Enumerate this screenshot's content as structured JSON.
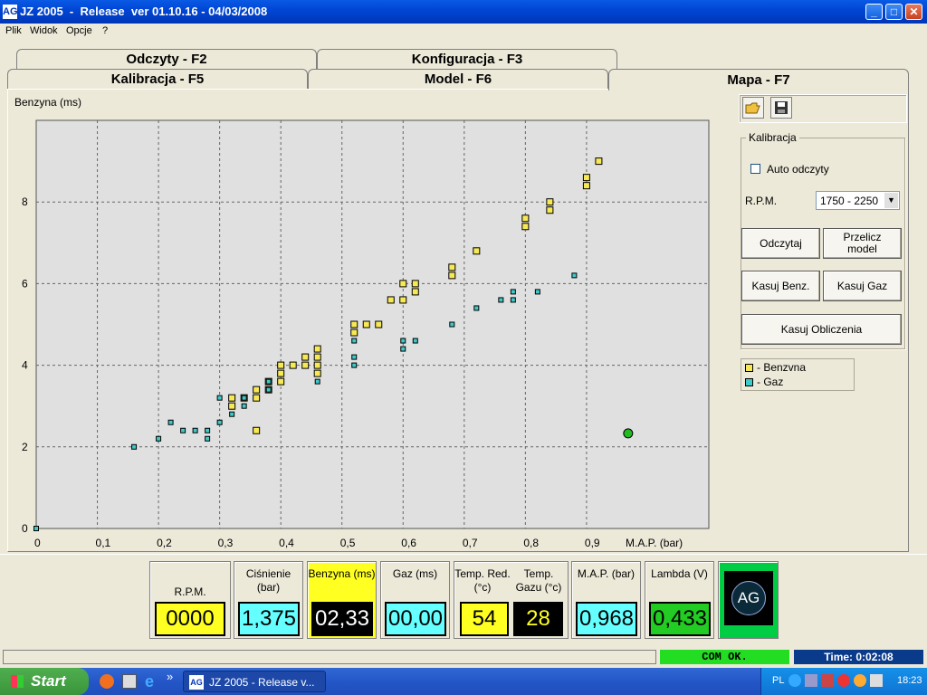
{
  "window": {
    "title": "JZ 2005  -  Release  ver 01.10.16 - 04/03/2008",
    "icon_text": "AG",
    "minimize": "_",
    "maximize": "□",
    "close": "✕"
  },
  "menu": [
    "Plik",
    "Widok",
    "Opcje",
    "?"
  ],
  "tabs": [
    {
      "label": "Odczyty - F2"
    },
    {
      "label": "Konfiguracja - F3"
    },
    {
      "label": "Kalibracja - F5"
    },
    {
      "label": "Model - F6"
    },
    {
      "label": "Mapa - F7"
    }
  ],
  "right_panel": {
    "group_title": "Kalibracja",
    "auto_label": "Auto odczyty",
    "auto_checked": false,
    "rpm_label": "R.P.M.",
    "rpm_value": "1750 - 2250",
    "buttons": {
      "odczytaj": "Odczytaj",
      "przelicz": "Przelicz model",
      "kasuj_benz": "Kasuj Benz.",
      "kasuj_gaz": "Kasuj Gaz",
      "kasuj_obl": "Kasuj Obliczenia"
    },
    "legend": {
      "benzyna": " - Benzvna",
      "gaz": " - Gaz"
    }
  },
  "chart_data": {
    "type": "scatter",
    "ylabel": "Benzyna (ms)",
    "xlabel": "M.A.P. (bar)",
    "xlim": [
      0,
      1.1
    ],
    "ylim": [
      0,
      10
    ],
    "x_ticks": [
      "0",
      "0,1",
      "0,2",
      "0,3",
      "0,4",
      "0,5",
      "0,6",
      "0,7",
      "0,8",
      "0,9"
    ],
    "y_ticks": [
      "0",
      "2",
      "4",
      "6",
      "8"
    ],
    "grid": true,
    "series": [
      {
        "name": "Benzvna",
        "color": "#f7e955",
        "points": [
          [
            0.32,
            3.2
          ],
          [
            0.32,
            3.0
          ],
          [
            0.34,
            3.2
          ],
          [
            0.36,
            3.4
          ],
          [
            0.36,
            3.2
          ],
          [
            0.36,
            2.4
          ],
          [
            0.38,
            3.6
          ],
          [
            0.38,
            3.4
          ],
          [
            0.4,
            4.0
          ],
          [
            0.4,
            3.8
          ],
          [
            0.4,
            3.6
          ],
          [
            0.42,
            4.0
          ],
          [
            0.44,
            4.2
          ],
          [
            0.44,
            4.0
          ],
          [
            0.46,
            4.4
          ],
          [
            0.46,
            4.2
          ],
          [
            0.46,
            4.0
          ],
          [
            0.46,
            3.8
          ],
          [
            0.52,
            5.0
          ],
          [
            0.52,
            4.8
          ],
          [
            0.54,
            5.0
          ],
          [
            0.56,
            5.0
          ],
          [
            0.58,
            5.6
          ],
          [
            0.6,
            6.0
          ],
          [
            0.6,
            5.6
          ],
          [
            0.62,
            6.0
          ],
          [
            0.62,
            5.8
          ],
          [
            0.68,
            6.4
          ],
          [
            0.68,
            6.2
          ],
          [
            0.72,
            6.8
          ],
          [
            0.8,
            7.6
          ],
          [
            0.8,
            7.4
          ],
          [
            0.84,
            8.0
          ],
          [
            0.84,
            7.8
          ],
          [
            0.9,
            8.6
          ],
          [
            0.9,
            8.4
          ],
          [
            0.92,
            9.0
          ]
        ]
      },
      {
        "name": "Gaz",
        "color": "#3fc9c9",
        "points": [
          [
            0.0,
            0.0
          ],
          [
            0.16,
            2.0
          ],
          [
            0.2,
            2.2
          ],
          [
            0.22,
            2.6
          ],
          [
            0.24,
            2.4
          ],
          [
            0.26,
            2.4
          ],
          [
            0.28,
            2.4
          ],
          [
            0.28,
            2.2
          ],
          [
            0.3,
            3.2
          ],
          [
            0.3,
            2.6
          ],
          [
            0.32,
            2.8
          ],
          [
            0.34,
            3.2
          ],
          [
            0.34,
            3.0
          ],
          [
            0.38,
            3.6
          ],
          [
            0.38,
            3.4
          ],
          [
            0.46,
            3.6
          ],
          [
            0.52,
            4.6
          ],
          [
            0.52,
            4.2
          ],
          [
            0.52,
            4.0
          ],
          [
            0.6,
            4.6
          ],
          [
            0.6,
            4.4
          ],
          [
            0.62,
            4.6
          ],
          [
            0.68,
            5.0
          ],
          [
            0.72,
            5.4
          ],
          [
            0.76,
            5.6
          ],
          [
            0.78,
            5.8
          ],
          [
            0.78,
            5.6
          ],
          [
            0.82,
            5.8
          ],
          [
            0.88,
            6.2
          ]
        ]
      }
    ],
    "current_point": {
      "x": 0.968,
      "y": 2.33,
      "color": "#22bb22"
    }
  },
  "gauges": {
    "rpm": {
      "label": "R.P.M.",
      "value": "0000",
      "bg": "#ffff22",
      "fg": "#000000"
    },
    "cisnienie": {
      "label": "Ciśnienie (bar)",
      "value": "1,375",
      "bg": "#66ffff",
      "fg": "#000000"
    },
    "benzyna": {
      "label": "Benzyna (ms)",
      "value": "02,33",
      "bg": "#000000",
      "fg": "#ffffff",
      "panel": "#ffff22"
    },
    "gaz": {
      "label": "Gaz (ms)",
      "value": "00,00",
      "bg": "#66ffff",
      "fg": "#000000"
    },
    "temp_red": {
      "label": "Temp. Red. (°c)",
      "value": "54",
      "bg": "#ffff22",
      "fg": "#000000"
    },
    "temp_gazu": {
      "label": "Temp. Gazu (°c)",
      "value": "28",
      "bg": "#000000",
      "fg": "#ffff22"
    },
    "map": {
      "label": "M.A.P. (bar)",
      "value": "0,968",
      "bg": "#66ffff",
      "fg": "#000000"
    },
    "lambda": {
      "label": "Lambda (V)",
      "value": "0,433",
      "bg": "#22cc22",
      "fg": "#000000"
    },
    "logo": "AG"
  },
  "status": {
    "com": "COM OK.",
    "time": "Time: 0:02:08"
  },
  "taskbar": {
    "start": "Start",
    "window_label": "JZ 2005 - Release v...",
    "chevron": "»",
    "lang": "PL",
    "clock": "18:23"
  }
}
